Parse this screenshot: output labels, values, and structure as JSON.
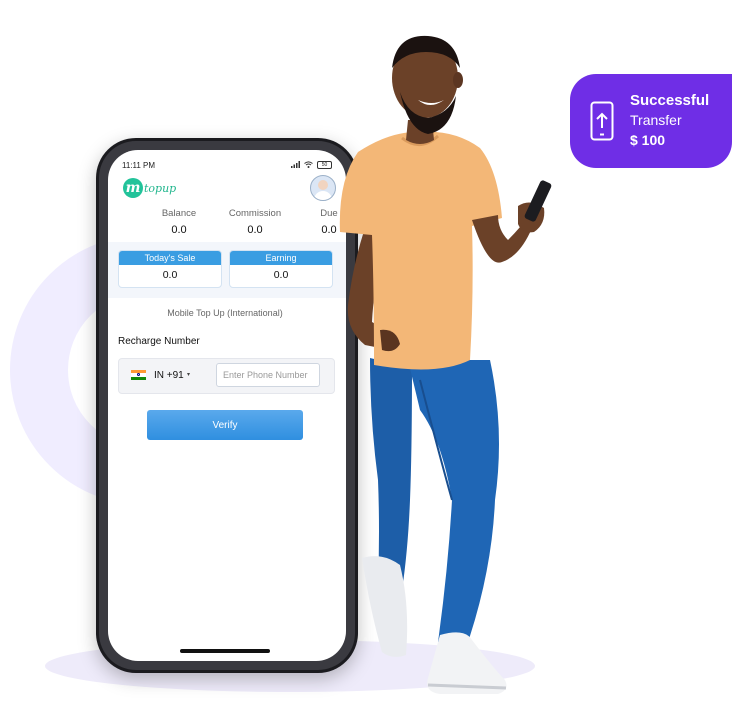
{
  "status_bar": {
    "time": "11:11 PM",
    "battery": "50"
  },
  "app": {
    "logo_letter": "m",
    "logo_text": "topup"
  },
  "stats": [
    {
      "label": "Balance",
      "value": "0.0"
    },
    {
      "label": "Commission",
      "value": "0.0"
    },
    {
      "label": "Due",
      "value": "0.0"
    }
  ],
  "cards": [
    {
      "label": "Today's Sale",
      "value": "0.0"
    },
    {
      "label": "Earning",
      "value": "0.0"
    }
  ],
  "section_title": "Mobile Top Up (International)",
  "recharge": {
    "label": "Recharge Number",
    "country": "IN +91",
    "caret": "▾",
    "placeholder": "Enter Phone Number"
  },
  "verify_label": "Verify",
  "toast": {
    "line1": "Successful",
    "line2": "Transfer",
    "amount": "$ 100"
  },
  "colors": {
    "accent_purple": "#6f2ee6",
    "button_blue": "#3a9de2",
    "brand_green": "#22c39a"
  }
}
